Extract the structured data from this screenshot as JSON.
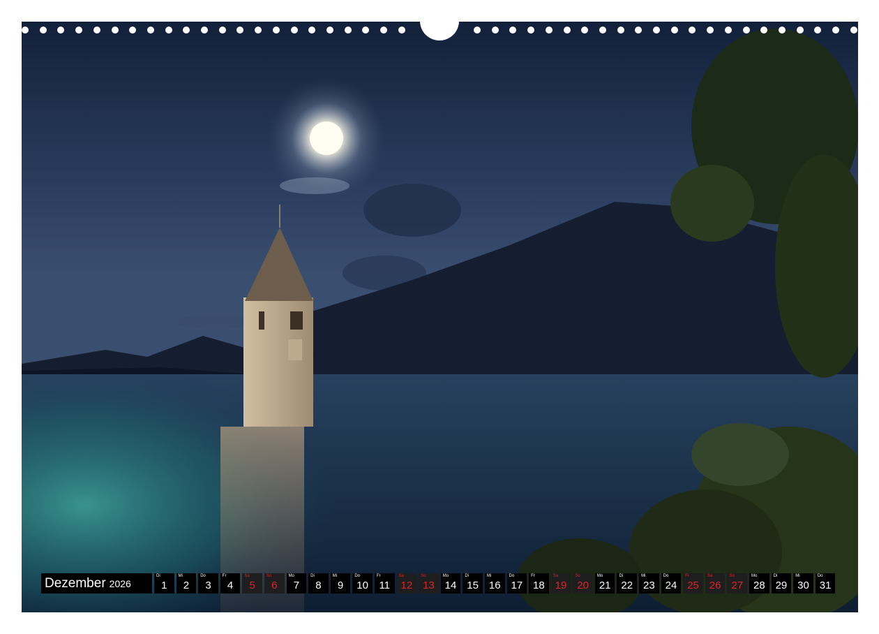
{
  "calendar": {
    "month": "Dezember",
    "year": "2026",
    "days": [
      {
        "wd": "Di",
        "d": "1",
        "we": false
      },
      {
        "wd": "Mi",
        "d": "2",
        "we": false
      },
      {
        "wd": "Do",
        "d": "3",
        "we": false
      },
      {
        "wd": "Fr",
        "d": "4",
        "we": false
      },
      {
        "wd": "Sa",
        "d": "5",
        "we": true
      },
      {
        "wd": "So",
        "d": "6",
        "we": true
      },
      {
        "wd": "Mo",
        "d": "7",
        "we": false
      },
      {
        "wd": "Di",
        "d": "8",
        "we": false
      },
      {
        "wd": "Mi",
        "d": "9",
        "we": false
      },
      {
        "wd": "Do",
        "d": "10",
        "we": false
      },
      {
        "wd": "Fr",
        "d": "11",
        "we": false
      },
      {
        "wd": "Sa",
        "d": "12",
        "we": true
      },
      {
        "wd": "So",
        "d": "13",
        "we": true
      },
      {
        "wd": "Mo",
        "d": "14",
        "we": false
      },
      {
        "wd": "Di",
        "d": "15",
        "we": false
      },
      {
        "wd": "Mi",
        "d": "16",
        "we": false
      },
      {
        "wd": "Do",
        "d": "17",
        "we": false
      },
      {
        "wd": "Fr",
        "d": "18",
        "we": false
      },
      {
        "wd": "Sa",
        "d": "19",
        "we": true
      },
      {
        "wd": "So",
        "d": "20",
        "we": true
      },
      {
        "wd": "Mo",
        "d": "21",
        "we": false
      },
      {
        "wd": "Di",
        "d": "22",
        "we": false
      },
      {
        "wd": "Mi",
        "d": "23",
        "we": false
      },
      {
        "wd": "Do",
        "d": "24",
        "we": false
      },
      {
        "wd": "Fr",
        "d": "25",
        "we": true
      },
      {
        "wd": "Sa",
        "d": "26",
        "we": true
      },
      {
        "wd": "So",
        "d": "27",
        "we": true
      },
      {
        "wd": "Mo",
        "d": "28",
        "we": false
      },
      {
        "wd": "Di",
        "d": "29",
        "we": false
      },
      {
        "wd": "Mi",
        "d": "30",
        "we": false
      },
      {
        "wd": "Do",
        "d": "31",
        "we": false
      }
    ]
  },
  "colors": {
    "weekend": "#e0232b",
    "day_bg": "#000000",
    "sky": "#1b2a44",
    "water": "#1a3550"
  },
  "photo": {
    "subject": "moonlit lake with submerged church tower",
    "icons": [
      "moon-icon",
      "church-tower-icon",
      "mountain-icon",
      "tree-icon"
    ]
  }
}
